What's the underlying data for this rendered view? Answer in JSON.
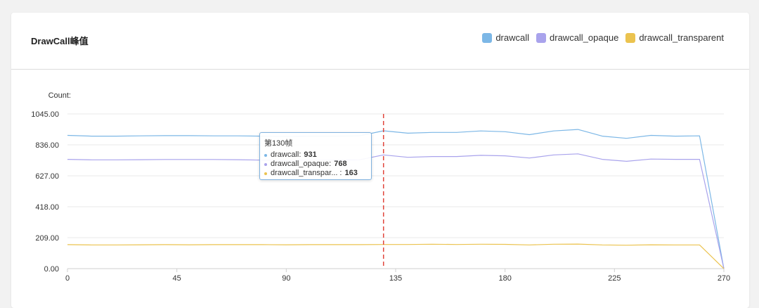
{
  "card": {
    "title": "DrawCall峰值"
  },
  "colors": {
    "drawcall": "#7cb7e6",
    "drawcall_opaque": "#a9a3ec",
    "drawcall_transparent": "#ebc34f",
    "grid": "#e8e8e8",
    "crosshair": "#e1463c"
  },
  "chart_data": {
    "type": "line",
    "ylabel": "Count:",
    "ylim": [
      0,
      1045
    ],
    "yticks": [
      "1045.00",
      "836.00",
      "627.00",
      "418.00",
      "209.00",
      "0.00"
    ],
    "xlim": [
      0,
      270
    ],
    "xticks": [
      "0",
      "45",
      "90",
      "135",
      "180",
      "225",
      "270"
    ],
    "grid": true,
    "legend_position": "top-right",
    "x": [
      0,
      10,
      20,
      30,
      40,
      50,
      60,
      70,
      80,
      90,
      100,
      110,
      120,
      130,
      140,
      150,
      160,
      170,
      180,
      190,
      200,
      210,
      220,
      230,
      240,
      250,
      260,
      270
    ],
    "series": [
      {
        "name": "drawcall",
        "values": [
          900,
          895,
          895,
          897,
          898,
          898,
          897,
          897,
          895,
          893,
          895,
          895,
          897,
          931,
          915,
          920,
          920,
          930,
          925,
          905,
          930,
          940,
          895,
          880,
          900,
          895,
          897,
          0
        ]
      },
      {
        "name": "drawcall_opaque",
        "values": [
          738,
          735,
          735,
          736,
          737,
          737,
          737,
          736,
          733,
          730,
          733,
          733,
          735,
          768,
          752,
          757,
          757,
          765,
          762,
          747,
          768,
          775,
          738,
          725,
          740,
          738,
          738,
          0
        ]
      },
      {
        "name": "drawcall_transparent",
        "values": [
          162,
          160,
          160,
          161,
          162,
          161,
          162,
          162,
          162,
          161,
          162,
          162,
          162,
          163,
          163,
          165,
          163,
          165,
          164,
          160,
          165,
          166,
          160,
          158,
          161,
          160,
          160,
          0
        ]
      }
    ],
    "hover": {
      "x": 130,
      "title": "第130帧",
      "rows": [
        {
          "label": "drawcall:",
          "value": "931",
          "color": "#7cb7e6"
        },
        {
          "label": "drawcall_opaque:",
          "value": "768",
          "color": "#a9a3ec"
        },
        {
          "label": "drawcall_transpar... :",
          "value": "163",
          "color": "#ebc34f"
        }
      ]
    }
  }
}
